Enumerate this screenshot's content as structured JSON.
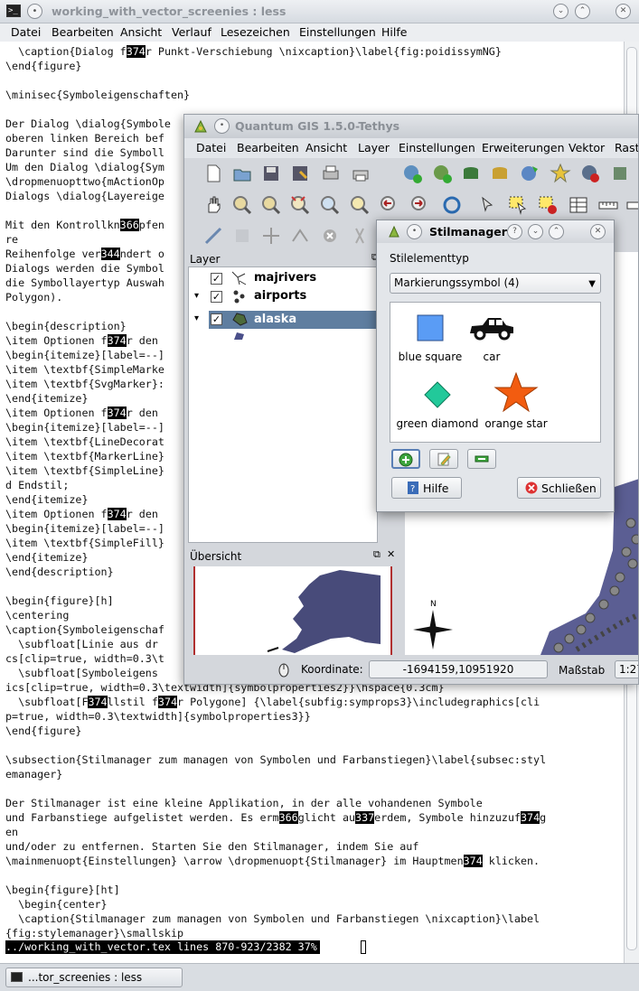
{
  "terminal": {
    "title": "working_with_vector_screenies : less",
    "menu": [
      "Datei",
      "Bearbeiten",
      "Ansicht",
      "Verlauf",
      "Lesezeichen",
      "Einstellungen",
      "Hilfe"
    ],
    "status_line": "../working_with_vector.tex lines 870-923/2382 37%",
    "taskbar_label": "...tor_screenies : less"
  },
  "text_lines": [
    [
      [
        "  \\caption{Dialog f",
        0
      ],
      [
        "374",
        1
      ],
      [
        "r Punkt-Verschiebung \\nixcaption}\\label{fig:poidissymNG}",
        0
      ]
    ],
    [
      [
        "\\end{figure}",
        0
      ]
    ],
    [
      [
        "",
        0
      ]
    ],
    [
      [
        "\\minisec{Symboleigenschaften}",
        0
      ]
    ],
    [
      [
        "",
        0
      ]
    ],
    [
      [
        "Der Dialog \\dialog{Symbole",
        0
      ]
    ],
    [
      [
        "oberen linken Bereich bef",
        0
      ]
    ],
    [
      [
        "Darunter sind die Symboll",
        0
      ]
    ],
    [
      [
        "Um den Dialog \\dialog{Sym",
        0
      ]
    ],
    [
      [
        "\\dropmenuopttwo{mActionOp",
        0
      ]
    ],
    [
      [
        "Dialogs \\dialog{Layereige",
        0
      ]
    ],
    [
      [
        "",
        0
      ]
    ],
    [
      [
        "Mit den Kontrollkn",
        0
      ],
      [
        "366",
        1
      ],
      [
        "pfen",
        0
      ]
    ],
    [
      [
        "re",
        0
      ]
    ],
    [
      [
        "Reihenfolge ver",
        0
      ],
      [
        "344",
        1
      ],
      [
        "ndert o",
        0
      ]
    ],
    [
      [
        "Dialogs werden die Symbol",
        0
      ]
    ],
    [
      [
        "die Symbollayertyp Auswah",
        0
      ]
    ],
    [
      [
        "Polygon).",
        0
      ]
    ],
    [
      [
        "",
        0
      ]
    ],
    [
      [
        "\\begin{description}",
        0
      ]
    ],
    [
      [
        "\\item Optionen f",
        0
      ],
      [
        "374",
        1
      ],
      [
        "r den",
        0
      ]
    ],
    [
      [
        "\\begin{itemize}[label=--]",
        0
      ]
    ],
    [
      [
        "\\item \\textbf{SimpleMarke",
        0
      ]
    ],
    [
      [
        "\\item \\textbf{SvgMarker}:",
        0
      ]
    ],
    [
      [
        "\\end{itemize}",
        0
      ]
    ],
    [
      [
        "\\item Optionen f",
        0
      ],
      [
        "374",
        1
      ],
      [
        "r den",
        0
      ]
    ],
    [
      [
        "\\begin{itemize}[label=--]",
        0
      ]
    ],
    [
      [
        "\\item \\textbf{LineDecorat",
        0
      ]
    ],
    [
      [
        "\\item \\textbf{MarkerLine}",
        0
      ]
    ],
    [
      [
        "\\item \\textbf{SimpleLine}",
        0
      ]
    ],
    [
      [
        "d Endstil;",
        0
      ]
    ],
    [
      [
        "\\end{itemize}",
        0
      ]
    ],
    [
      [
        "\\item Optionen f",
        0
      ],
      [
        "374",
        1
      ],
      [
        "r den",
        0
      ]
    ],
    [
      [
        "\\begin{itemize}[label=--]",
        0
      ]
    ],
    [
      [
        "\\item \\textbf{SimpleFill}",
        0
      ]
    ],
    [
      [
        "\\end{itemize}",
        0
      ]
    ],
    [
      [
        "\\end{description}",
        0
      ]
    ],
    [
      [
        "",
        0
      ]
    ],
    [
      [
        "\\begin{figure}[h]",
        0
      ]
    ],
    [
      [
        "\\centering",
        0
      ]
    ],
    [
      [
        "\\caption{Symboleigenschaf",
        0
      ]
    ],
    [
      [
        "  \\subfloat[Linie aus dr",
        0
      ]
    ],
    [
      [
        "cs[clip=true, width=0.3\\t",
        0
      ]
    ],
    [
      [
        "  \\subfloat[Symboleigens",
        0
      ]
    ],
    [
      [
        "ics[clip=true, width=0.3\\textwidth]{symbolproperties2}}\\hspace{0.3cm}",
        0
      ]
    ],
    [
      [
        "  \\subfloat[F",
        0
      ],
      [
        "374",
        1
      ],
      [
        "llstil f",
        0
      ],
      [
        "374",
        1
      ],
      [
        "r Polygone] {\\label{subfig:symprops3}\\includegraphics[cli",
        0
      ]
    ],
    [
      [
        "p=true, width=0.3\\textwidth]{symbolproperties3}}",
        0
      ]
    ],
    [
      [
        "\\end{figure}",
        0
      ]
    ],
    [
      [
        "",
        0
      ]
    ],
    [
      [
        "\\subsection{Stilmanager zum managen von Symbolen und Farbanstiegen}\\label{subsec:styl",
        0
      ]
    ],
    [
      [
        "emanager}",
        0
      ]
    ],
    [
      [
        "",
        0
      ]
    ],
    [
      [
        "Der Stilmanager ist eine kleine Applikation, in der alle vohandenen Symbole",
        0
      ]
    ],
    [
      [
        "und Farbanstiege aufgelistet werden. Es erm",
        0
      ],
      [
        "366",
        1
      ],
      [
        "glicht au",
        0
      ],
      [
        "337",
        1
      ],
      [
        "erdem, Symbole hinzuzuf",
        0
      ],
      [
        "374",
        1
      ],
      [
        "g",
        0
      ]
    ],
    [
      [
        "en",
        0
      ]
    ],
    [
      [
        "und/oder zu entfernen. Starten Sie den Stilmanager, indem Sie auf",
        0
      ]
    ],
    [
      [
        "\\mainmenuopt{Einstellungen} \\arrow \\dropmenuopt{Stilmanager} im Hauptmen",
        0
      ],
      [
        "374",
        1
      ],
      [
        " klicken.",
        0
      ]
    ],
    [
      [
        "",
        0
      ]
    ],
    [
      [
        "\\begin{figure}[ht]",
        0
      ]
    ],
    [
      [
        "  \\begin{center}",
        0
      ]
    ],
    [
      [
        "  \\caption{Stilmanager zum managen von Symbolen und Farbanstiegen \\nixcaption}\\label",
        0
      ]
    ],
    [
      [
        "{fig:stylemanager}\\smallskip",
        0
      ]
    ]
  ],
  "qgis": {
    "title": "Quantum GIS 1.5.0-Tethys",
    "menu": [
      "Datei",
      "Bearbeiten",
      "Ansicht",
      "Layer",
      "Einstellungen",
      "Erweiterungen",
      "Vektor",
      "Rast"
    ],
    "layer_panel_title": "Layer",
    "layers": [
      {
        "name": "majrivers",
        "checked": true
      },
      {
        "name": "airports",
        "checked": true
      },
      {
        "name": "alaska",
        "checked": true
      }
    ],
    "overview_title": "Übersicht",
    "coordinate_label": "Koordinate:",
    "coordinate_value": "-1694159,10951920",
    "scale_label": "Maßstab",
    "scale_value": "1:27",
    "north_label": "N"
  },
  "stilmanager": {
    "title": "Stilmanager",
    "type_label": "Stilelementtyp",
    "type_value": "Markierungssymbol (4)",
    "symbols": [
      {
        "label": "blue square",
        "icon": "blue-square-icon",
        "color": "#5a9cf5"
      },
      {
        "label": "car",
        "icon": "car-icon",
        "color": "#111111"
      },
      {
        "label": "green diamond",
        "icon": "green-diamond-icon",
        "color": "#22c99a"
      },
      {
        "label": "orange star",
        "icon": "orange-star-icon",
        "color": "#f25c10"
      }
    ],
    "help_label": "Hilfe",
    "close_label": "Schließen"
  }
}
